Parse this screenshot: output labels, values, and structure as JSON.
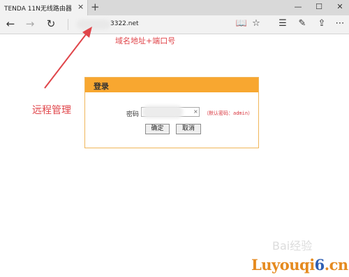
{
  "browser": {
    "tab_title": "TENDA 11N无线路由器",
    "tab_close": "×",
    "new_tab": "+",
    "address_url_visible": "3322.net"
  },
  "icons": {
    "back": "←",
    "forward": "→",
    "refresh": "↻",
    "reading_view": "📖",
    "favorite": "☆",
    "hub": "☰",
    "web_note": "✎",
    "share": "⇪",
    "minimize": "—",
    "maximize": "☐",
    "close": "✕"
  },
  "annotations": {
    "domain_port": "域名地址+端口号",
    "remote_manage": "远程管理",
    "color": "#e0454a"
  },
  "login": {
    "title": "登录",
    "password_label": "密码",
    "clear_icon": "×",
    "hint": "（默认密码：admin）",
    "ok_label": "确定",
    "cancel_label": "取消",
    "header_color": "#f8a730"
  },
  "watermark": {
    "baidu": "Bai经验",
    "site_part1": "Luyouqi",
    "site_part2": "6",
    "site_part3": ".cn"
  }
}
